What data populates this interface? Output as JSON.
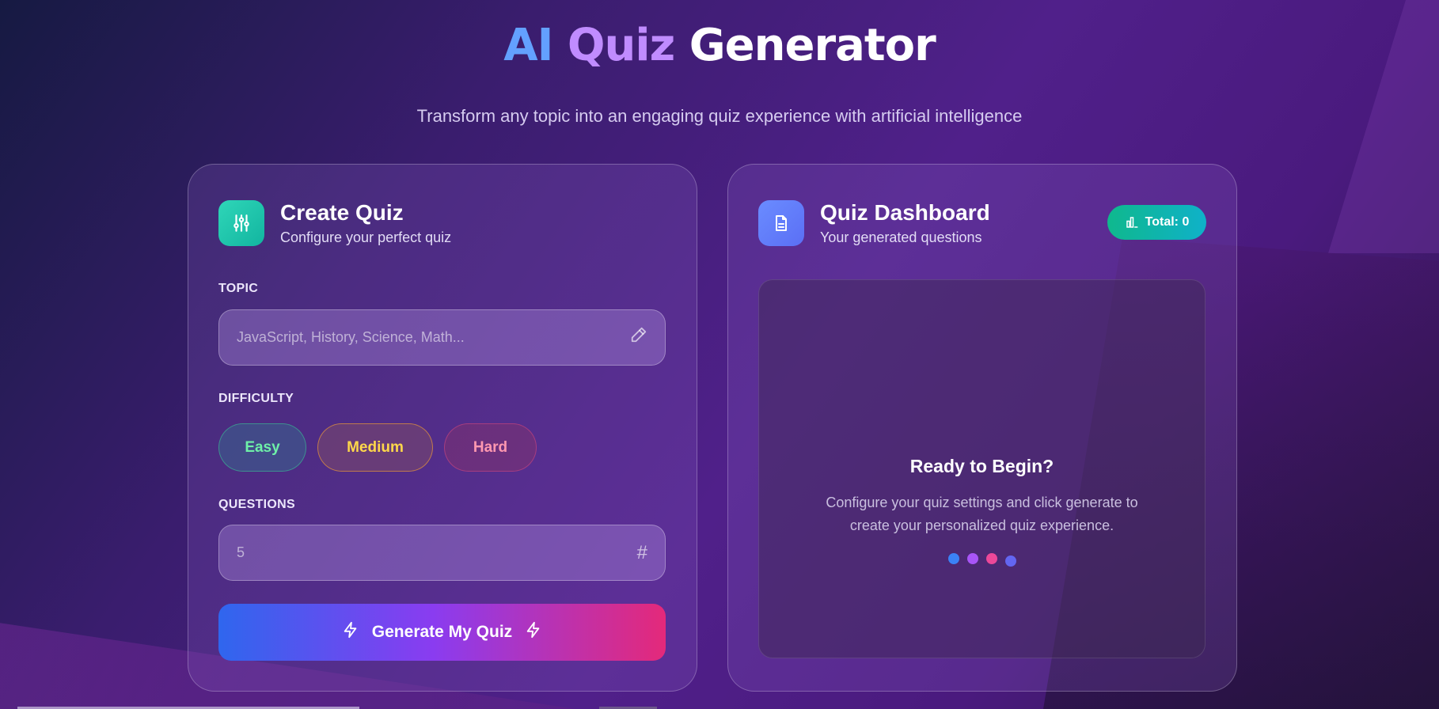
{
  "header": {
    "title_ai": "AI",
    "title_quiz": "Quiz",
    "title_generator": "Generator",
    "subtitle": "Transform any topic into an engaging quiz experience with artificial intelligence"
  },
  "create": {
    "title": "Create Quiz",
    "subtitle": "Configure your perfect quiz",
    "icon": "sliders-icon",
    "topic_label": "TOPIC",
    "topic_placeholder": "JavaScript, History, Science, Math...",
    "difficulty_label": "DIFFICULTY",
    "difficulties": [
      "Easy",
      "Medium",
      "Hard"
    ],
    "questions_label": "QUESTIONS",
    "questions_placeholder": "5",
    "generate_label": "Generate My Quiz"
  },
  "dashboard": {
    "title": "Quiz Dashboard",
    "subtitle": "Your generated questions",
    "icon": "document-icon",
    "total_badge": "Total: 0",
    "empty_title": "Ready to Begin?",
    "empty_text": "Configure your quiz settings and click generate to create your personalized quiz experience.",
    "dot_colors": [
      "#3b82f6",
      "#a855f7",
      "#ec4899",
      "#6366f1"
    ]
  },
  "colors": {
    "easy": "#6ef0a8",
    "medium": "#ffd84a",
    "hard": "#ff98b0",
    "accent_teal": "#12b5a0"
  }
}
